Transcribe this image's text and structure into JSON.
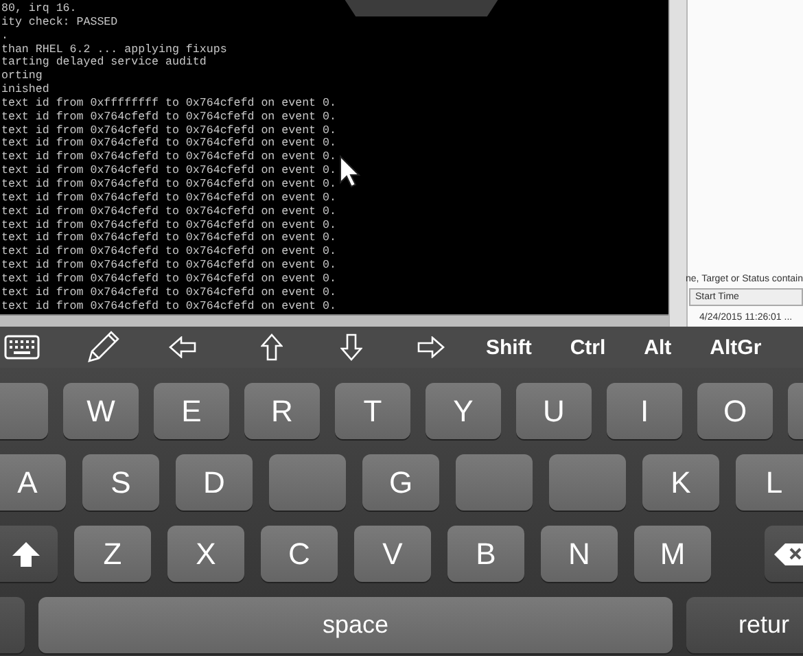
{
  "terminal": {
    "lines": [
      "80, irq 16.",
      "ity check: PASSED",
      ".",
      "than RHEL 6.2 ... applying fixups",
      "tarting delayed service auditd",
      "orting",
      "inished",
      "text id from 0xffffffff to 0x764cfefd on event 0.",
      "text id from 0x764cfefd to 0x764cfefd on event 0.",
      "text id from 0x764cfefd to 0x764cfefd on event 0.",
      "text id from 0x764cfefd to 0x764cfefd on event 0.",
      "text id from 0x764cfefd to 0x764cfefd on event 0.",
      "text id from 0x764cfefd to 0x764cfefd on event 0.",
      "text id from 0x764cfefd to 0x764cfefd on event 0.",
      "text id from 0x764cfefd to 0x764cfefd on event 0.",
      "text id from 0x764cfefd to 0x764cfefd on event 0.",
      "text id from 0x764cfefd to 0x764cfefd on event 0.",
      "text id from 0x764cfefd to 0x764cfefd on event 0.",
      "text id from 0x764cfefd to 0x764cfefd on event 0.",
      "text id from 0x764cfefd to 0x764cfefd on event 0.",
      "text id from 0x764cfefd to 0x764cfefd on event 0.",
      "text id from 0x764cfefd to 0x764cfefd on event 0.",
      "text id from 0x764cfefd to 0x764cfefd on event 0."
    ]
  },
  "panel": {
    "filter_hint": "ne, Target or Status contain",
    "column_1": "Start Time",
    "rows": [
      "4/24/2015 11:26:01 ..."
    ]
  },
  "toolbar": {
    "modifiers": [
      "Shift",
      "Ctrl",
      "Alt",
      "AltGr"
    ]
  },
  "keyboard": {
    "rows": [
      [
        {
          "kind": "blank"
        },
        {
          "kind": "letter",
          "label": "W"
        },
        {
          "kind": "letter",
          "label": "E"
        },
        {
          "kind": "letter",
          "label": "R"
        },
        {
          "kind": "letter",
          "label": "T"
        },
        {
          "kind": "letter",
          "label": "Y"
        },
        {
          "kind": "letter",
          "label": "U"
        },
        {
          "kind": "letter",
          "label": "I"
        },
        {
          "kind": "letter",
          "label": "O"
        },
        {
          "kind": "blank"
        }
      ],
      [
        {
          "kind": "letter",
          "label": "A"
        },
        {
          "kind": "letter",
          "label": "S"
        },
        {
          "kind": "letter",
          "label": "D"
        },
        {
          "kind": "blank"
        },
        {
          "kind": "letter",
          "label": "G"
        },
        {
          "kind": "blank"
        },
        {
          "kind": "blank"
        },
        {
          "kind": "letter",
          "label": "K"
        },
        {
          "kind": "letter",
          "label": "L"
        }
      ],
      [
        {
          "kind": "shift"
        },
        {
          "kind": "letter",
          "label": "Z"
        },
        {
          "kind": "letter",
          "label": "X"
        },
        {
          "kind": "letter",
          "label": "C"
        },
        {
          "kind": "letter",
          "label": "V"
        },
        {
          "kind": "letter",
          "label": "B"
        },
        {
          "kind": "letter",
          "label": "N"
        },
        {
          "kind": "letter",
          "label": "M"
        },
        {
          "kind": "backspace"
        }
      ],
      [
        {
          "kind": "blank"
        },
        {
          "kind": "space",
          "label": "space"
        },
        {
          "kind": "return",
          "label": "retur"
        }
      ]
    ]
  }
}
